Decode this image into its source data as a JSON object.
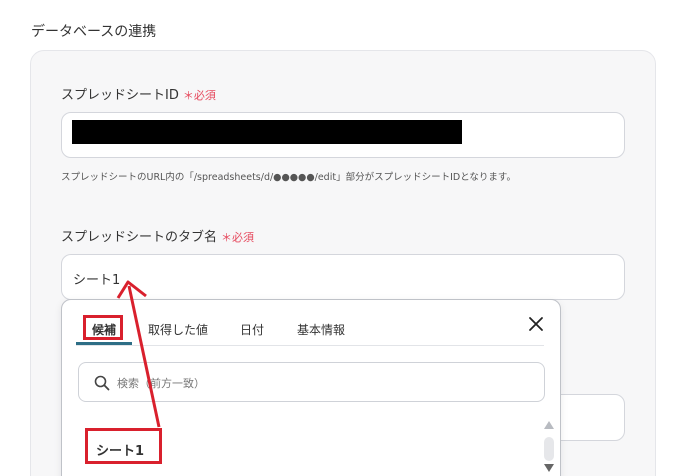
{
  "section_title": "データベースの連携",
  "spreadsheet_id": {
    "label": "スプレッドシートID",
    "required_mark": "＊",
    "required_text": "必須",
    "value": "",
    "help": "スプレッドシートのURL内の「/spreadsheets/d/●●●●●/edit」部分がスプレッドシートIDとなります。"
  },
  "tab_name": {
    "label": "スプレッドシートのタブ名",
    "required_mark": "＊",
    "required_text": "必須",
    "value": "シート1"
  },
  "dropdown": {
    "tabs": [
      "候補",
      "取得した値",
      "日付",
      "基本情報"
    ],
    "active_tab": "候補",
    "search_placeholder": "検索（前方一致）",
    "options": [
      "シート1"
    ]
  },
  "colors": {
    "accent": "#2d6e86",
    "required": "#e64a5e",
    "annotation": "#d9202d"
  }
}
